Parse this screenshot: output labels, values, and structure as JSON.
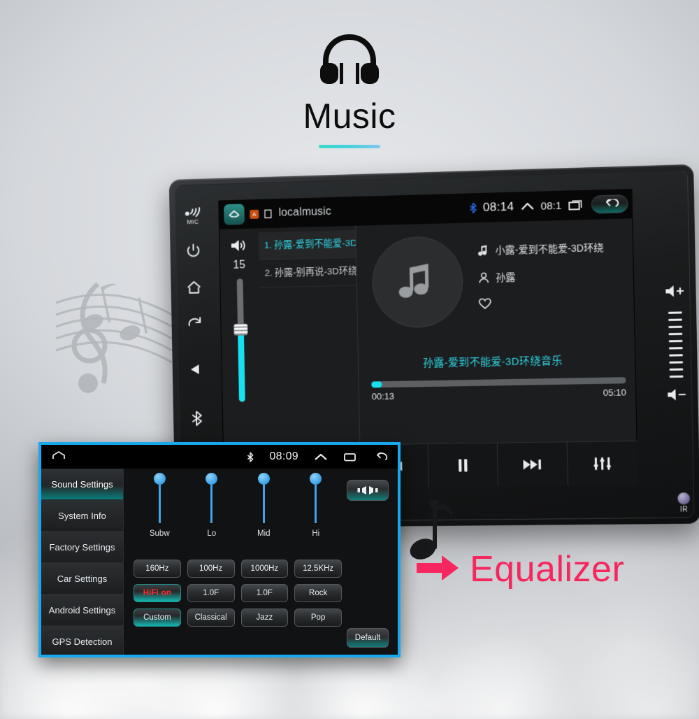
{
  "header": {
    "title": "Music",
    "icon": "headphones-icon"
  },
  "annotation": {
    "label": "Equalizer",
    "arrow_icon": "right-arrow-icon",
    "color": "#f6265e"
  },
  "head_unit": {
    "left_keys": [
      {
        "icon": "mic-icon",
        "label": "MIC"
      },
      {
        "icon": "power-icon",
        "label": ""
      },
      {
        "icon": "home-icon",
        "label": ""
      },
      {
        "icon": "return-icon",
        "label": ""
      },
      {
        "icon": "play-triangle-icon",
        "label": ""
      },
      {
        "icon": "bluetooth-icon",
        "label": ""
      }
    ],
    "right_keys": {
      "volume_up_icon": "volume-up-icon",
      "volume_down_icon": "volume-down-icon",
      "tick_count": 10
    },
    "ir": {
      "label": "IR",
      "icon": "ir-receiver-icon"
    }
  },
  "music_app": {
    "statusbar": {
      "launcher_icon": "launcher-home-icon",
      "badge": "A",
      "title": "localmusic",
      "bluetooth_icon": "bluetooth-icon",
      "time": "08:14",
      "chevron_up_icon": "chevron-up-icon",
      "time_secondary": "08:1",
      "recents_icon": "recents-icon",
      "back_icon": "back-icon"
    },
    "volume": {
      "speaker_icon": "speaker-icon",
      "value": "15"
    },
    "playlist": [
      {
        "index": "1.",
        "title": "孙露-爱到不能爱-3D",
        "playing_icon": "now-playing-icon",
        "active": true
      },
      {
        "index": "2.",
        "title": "孙露-别再说-3D环绕...",
        "playing_icon": "",
        "active": false
      }
    ],
    "album_art_icon": "music-note-icon",
    "now_playing": {
      "track_icon": "music-note-icon",
      "track": "小露-爱到不能爱-3D环绕",
      "artist_icon": "person-icon",
      "artist": "孙露",
      "favorite_icon": "heart-icon"
    },
    "lyric": "孙露-爱到不能爱-3D环绕音乐",
    "progress": {
      "current": "00:13",
      "total": "05:10",
      "percent": 4.2
    },
    "toolbar": [
      {
        "name": "playlist-button",
        "icon": "list-icon"
      },
      {
        "name": "shuffle-button",
        "icon": "shuffle-icon"
      },
      {
        "name": "previous-button",
        "icon": "previous-icon"
      },
      {
        "name": "pause-button",
        "icon": "pause-icon"
      },
      {
        "name": "next-button",
        "icon": "next-icon"
      },
      {
        "name": "equalizer-button",
        "icon": "equalizer-sliders-icon"
      }
    ]
  },
  "equalizer_app": {
    "statusbar": {
      "home_icon": "home-icon",
      "bluetooth_icon": "bluetooth-icon",
      "time": "08:09",
      "chevron_up_icon": "chevron-up-icon",
      "recents_icon": "recents-icon",
      "back_icon": "back-icon"
    },
    "sidebar": [
      {
        "label": "Sound Settings",
        "active": true
      },
      {
        "label": "System Info",
        "active": false
      },
      {
        "label": "Factory Settings",
        "active": false
      },
      {
        "label": "Car Settings",
        "active": false
      },
      {
        "label": "Android Settings",
        "active": false
      },
      {
        "label": "GPS Detection",
        "active": false
      }
    ],
    "sliders": [
      {
        "label": "Subw",
        "value": 100
      },
      {
        "label": "Lo",
        "value": 100
      },
      {
        "label": "Mid",
        "value": 100
      },
      {
        "label": "Hi",
        "value": 100
      }
    ],
    "buttons": [
      [
        {
          "label": "160Hz",
          "active": false
        },
        {
          "label": "100Hz",
          "active": false
        },
        {
          "label": "1000Hz",
          "active": false
        },
        {
          "label": "12.5KHz",
          "active": false
        }
      ],
      [
        {
          "label": "HiFi on",
          "active": true,
          "style": "hifi"
        },
        {
          "label": "1.0F",
          "active": false
        },
        {
          "label": "1.0F",
          "active": false
        },
        {
          "label": "Rock",
          "active": false
        }
      ],
      [
        {
          "label": "Custom",
          "active": true
        },
        {
          "label": "Classical",
          "active": false
        },
        {
          "label": "Jazz",
          "active": false
        },
        {
          "label": "Pop",
          "active": false
        }
      ]
    ],
    "balance_button": {
      "icon": "balance-fader-icon"
    },
    "default_button": {
      "label": "Default"
    },
    "accent_border": "#16a9ef"
  }
}
